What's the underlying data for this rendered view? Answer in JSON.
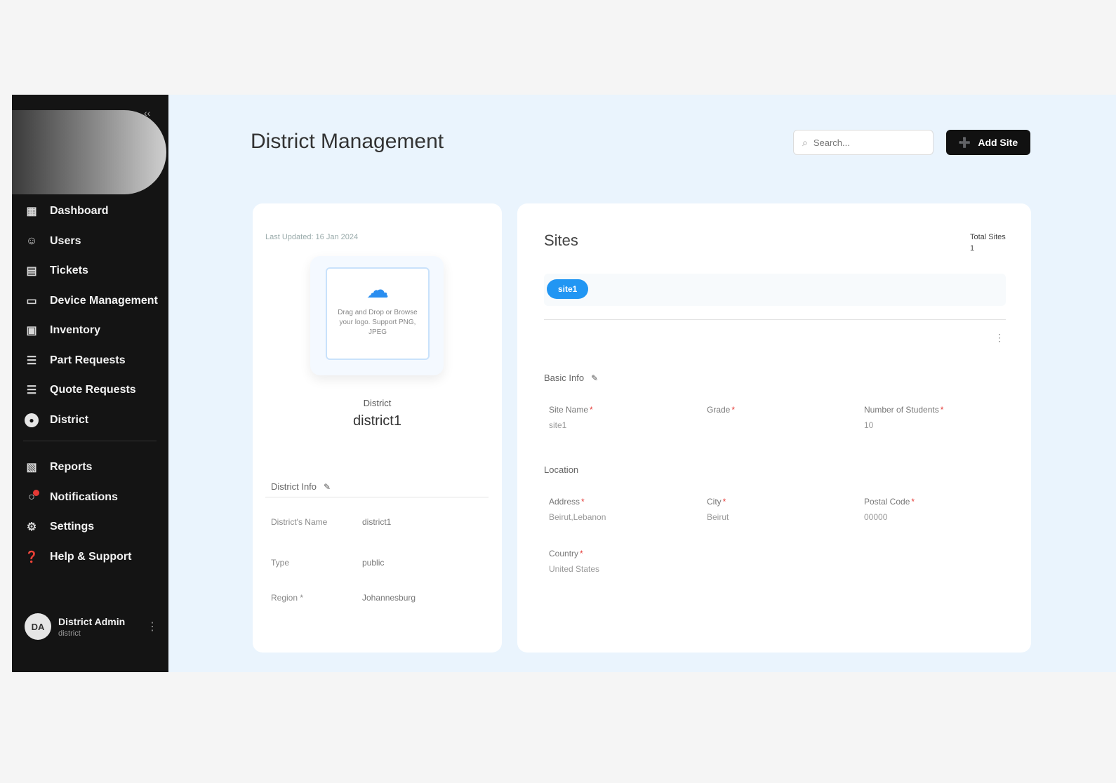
{
  "sidebar": {
    "items": [
      {
        "label": "Dashboard",
        "icon": "grid-icon"
      },
      {
        "label": "Users",
        "icon": "users-icon"
      },
      {
        "label": "Tickets",
        "icon": "ticket-icon"
      },
      {
        "label": "Device Management",
        "icon": "device-icon"
      },
      {
        "label": "Inventory",
        "icon": "inventory-icon"
      },
      {
        "label": "Part Requests",
        "icon": "cart-icon"
      },
      {
        "label": "Quote Requests",
        "icon": "cart-icon"
      },
      {
        "label": "District",
        "icon": "globe-icon"
      }
    ],
    "bottom_items": [
      {
        "label": "Reports",
        "icon": "reports-icon"
      },
      {
        "label": "Notifications",
        "icon": "bell-icon"
      },
      {
        "label": "Settings",
        "icon": "gear-icon"
      },
      {
        "label": "Help & Support",
        "icon": "help-icon"
      }
    ],
    "user": {
      "initials": "DA",
      "name": "District Admin",
      "role": "district"
    }
  },
  "header": {
    "title": "District Management",
    "search_placeholder": "Search...",
    "add_button_label": "Add Site"
  },
  "district_card": {
    "updated_text": "Last Updated: 16 Jan 2024",
    "upload_text": "Drag and Drop or Browse your logo. Support PNG, JPEG",
    "name_label": "District",
    "name_value": "district1",
    "info_title": "District Info",
    "rows": [
      {
        "key": "District's Name",
        "value": "district1"
      },
      {
        "key": "Type",
        "value": "public"
      },
      {
        "key": "Region *",
        "value": "Johannesburg"
      }
    ]
  },
  "sites_card": {
    "title": "Sites",
    "total_label": "Total Sites",
    "total_value": "1",
    "chip_label": "site1",
    "basic_info_title": "Basic Info",
    "basic_fields": [
      {
        "label": "Site Name",
        "value": "site1"
      },
      {
        "label": "Grade",
        "value": ""
      },
      {
        "label": "Number of Students",
        "value": "10"
      }
    ],
    "location_title": "Location",
    "location_fields": [
      {
        "label": "Address",
        "value": "Beirut,Lebanon"
      },
      {
        "label": "City",
        "value": "Beirut"
      },
      {
        "label": "Postal Code",
        "value": "00000"
      }
    ],
    "country_field": {
      "label": "Country",
      "value": "United States"
    }
  },
  "colors": {
    "sidebar_bg": "#141414",
    "main_bg": "#eaf4fd",
    "accent": "#2196f3",
    "button_dark": "#111111",
    "required": "#e53935"
  }
}
